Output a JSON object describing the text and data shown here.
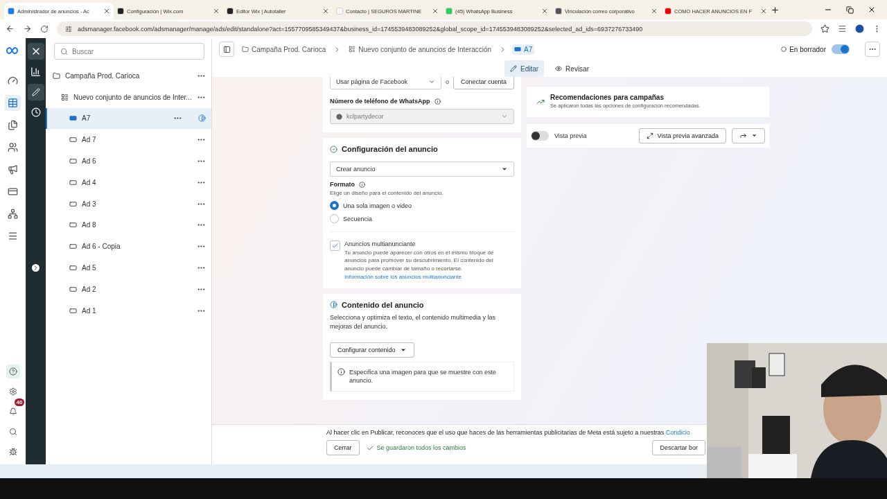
{
  "browser": {
    "tabs": [
      {
        "title": "Administrador de anuncios - Ac",
        "selected": true
      },
      {
        "title": "Configuración | Wix.com",
        "selected": false
      },
      {
        "title": "Editor Wix | Autotaller",
        "selected": false
      },
      {
        "title": "Contacto | SEGUROS MARTINE",
        "selected": false
      },
      {
        "title": "(45) WhatsApp Business",
        "selected": false
      },
      {
        "title": "Vinculación correo corporativo",
        "selected": false
      },
      {
        "title": "COMO HACER ANUNCIOS EN F",
        "selected": false
      }
    ],
    "address": "adsmanager.facebook.com/adsmanager/manage/ads/edit/standalone?act=1557709585349437&business_id=1745539483089252&global_scope_id=1745539483089252&selected_ad_ids=6937276733490"
  },
  "rail": {
    "notifications_badge": "40"
  },
  "tree": {
    "search_placeholder": "Buscar",
    "items": [
      {
        "label": "Campaña Prod. Carioca",
        "kind": "campaign",
        "selected": false,
        "children": [
          {
            "label": "Nuevo conjunto de anuncios de Inter...",
            "kind": "adset",
            "selected": false,
            "children": [
              {
                "label": "A7",
                "kind": "ad",
                "selected": true
              },
              {
                "label": "Ad 7",
                "kind": "ad",
                "selected": false
              },
              {
                "label": "Ad 6",
                "kind": "ad",
                "selected": false
              },
              {
                "label": "Ad 4",
                "kind": "ad",
                "selected": false
              },
              {
                "label": "Ad 3",
                "kind": "ad",
                "selected": false
              },
              {
                "label": "Ad 8",
                "kind": "ad",
                "selected": false
              },
              {
                "label": "Ad 6 - Copia",
                "kind": "ad",
                "selected": false
              },
              {
                "label": "Ad 5",
                "kind": "ad",
                "selected": false
              },
              {
                "label": "Ad 2",
                "kind": "ad",
                "selected": false
              },
              {
                "label": "Ad 1",
                "kind": "ad",
                "selected": false
              }
            ]
          }
        ]
      }
    ]
  },
  "header": {
    "breadcrumb": [
      "Campaña Prod. Carioca",
      "Nuevo conjunto de anuncios de Interacción",
      "A7"
    ],
    "status": "En borrador",
    "toggle_on": true
  },
  "mode_tabs": [
    {
      "label": "Editar",
      "selected": true
    },
    {
      "label": "Revisar",
      "selected": false
    }
  ],
  "identity": {
    "page_select": "Usar página de Facebook",
    "or": "o",
    "connect": "Conectar cuenta",
    "whatsapp_label": "Número de teléfono de WhatsApp",
    "whatsapp_value": "kclpartydecor"
  },
  "ad_setup": {
    "title": "Configuración del anuncio",
    "creation": "Crear anuncio",
    "format_label": "Formato",
    "format_hint": "Elige un diseño para el contenido del anuncio.",
    "formats": [
      {
        "label": "Una sola imagen o video",
        "selected": true
      },
      {
        "label": "Secuencia",
        "selected": false
      }
    ],
    "multi": {
      "label": "Anuncios multianunciante",
      "checked": true,
      "text": "Tu anuncio puede aparecer con otros en el mismo bloque de anuncios para promover su descubrimiento. El contenido del anuncio puede cambiar de tamaño o recortarse.",
      "link": "Información sobre los anuncios multianunciante"
    }
  },
  "ad_content": {
    "title": "Contenido del anuncio",
    "text": "Selecciona y optimiza el texto, el contenido multimedia y las mejoras del anuncio.",
    "button": "Configurar contenido",
    "notice": "Especifica una imagen para que se muestre con este anuncio."
  },
  "recommendations": {
    "title": "Recomendaciones para campañas",
    "subtitle": "Se aplicaron todas las opciones de configuración recomendadas."
  },
  "preview": {
    "label": "Vista previa",
    "on": false,
    "advanced": "Vista previa avanzada"
  },
  "footer": {
    "text": "Al hacer clic en Publicar, reconoces que el uso que haces de las herramientas publicitarias de Meta está sujeto a nuestras",
    "link": "Condicio",
    "close": "Cerrar",
    "saved": "Se guardaron todos los cambios",
    "discard": "Descartar bor"
  }
}
